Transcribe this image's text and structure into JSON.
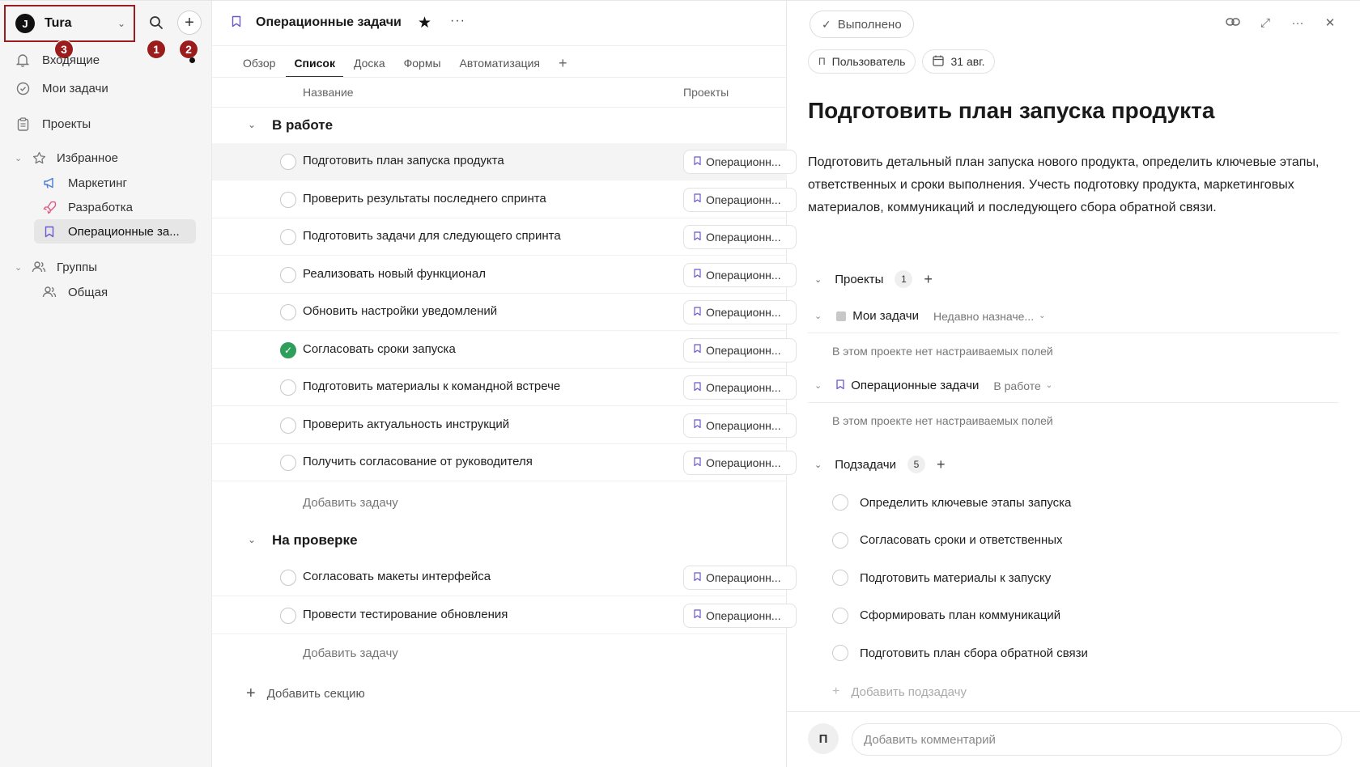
{
  "sidebar": {
    "workspace": {
      "logo": "J",
      "name": "Tura"
    },
    "badges": [
      "1",
      "2",
      "3"
    ],
    "nav": {
      "inbox": "Входящие",
      "my_tasks": "Мои задачи",
      "projects": "Проекты"
    },
    "favorites": {
      "label": "Избранное",
      "items": [
        "Маркетинг",
        "Разработка",
        "Операционные за..."
      ]
    },
    "groups": {
      "label": "Группы",
      "items": [
        "Общая"
      ]
    }
  },
  "middle": {
    "project_title": "Операционные задачи",
    "tabs": [
      "Обзор",
      "Список",
      "Доска",
      "Формы",
      "Автоматизация"
    ],
    "active_tab": "Список",
    "columns": {
      "name": "Название",
      "projects": "Проекты"
    },
    "sections": [
      {
        "title": "В работе",
        "tasks": [
          {
            "name": "Подготовить план запуска продукта",
            "project": "Операционн...",
            "done": false
          },
          {
            "name": "Проверить результаты последнего спринта",
            "project": "Операционн...",
            "done": false
          },
          {
            "name": "Подготовить задачи для следующего спринта",
            "project": "Операционн...",
            "done": false
          },
          {
            "name": "Реализовать новый функционал",
            "project": "Операционн...",
            "done": false
          },
          {
            "name": "Обновить настройки уведомлений",
            "project": "Операционн...",
            "done": false
          },
          {
            "name": "Согласовать сроки запуска",
            "project": "Операционн...",
            "done": true
          },
          {
            "name": "Подготовить материалы к командной встрече",
            "project": "Операционн...",
            "done": false
          },
          {
            "name": "Проверить актуальность инструкций",
            "project": "Операционн...",
            "done": false
          },
          {
            "name": "Получить согласование от руководителя",
            "project": "Операционн...",
            "done": false
          }
        ],
        "add_task": "Добавить задачу"
      },
      {
        "title": "На проверке",
        "tasks": [
          {
            "name": "Согласовать макеты интерфейса",
            "project": "Операционн...",
            "done": false
          },
          {
            "name": "Провести тестирование обновления",
            "project": "Операционн...",
            "done": false
          }
        ],
        "add_task": "Добавить задачу"
      }
    ],
    "add_section": "Добавить секцию"
  },
  "detail": {
    "done_label": "Выполнено",
    "assignee_initial": "П",
    "assignee": "Пользователь",
    "due_date": "31 авг.",
    "title": "Подготовить план запуска продукта",
    "description": "Подготовить детальный план запуска нового продукта, определить ключевые этапы, ответственных и сроки выполнения. Учесть подготовку продукта, маркетинговых материалов, коммуникаций и последующего сбора обратной связи.",
    "projects_label": "Проекты",
    "projects_count": "1",
    "project_lines": [
      {
        "name": "Мои задачи",
        "status": "Недавно назначе...",
        "note": "В этом проекте нет настраиваемых полей"
      },
      {
        "name": "Операционные задачи",
        "status": "В работе",
        "note": "В этом проекте нет настраиваемых полей"
      }
    ],
    "subtasks_label": "Подзадачи",
    "subtasks_count": "5",
    "subtasks": [
      "Определить ключевые этапы запуска",
      "Согласовать сроки и ответственных",
      "Подготовить материалы к запуску",
      "Сформировать план коммуникаций",
      "Подготовить план сбора обратной связи"
    ],
    "add_subtask": "Добавить подзадачу",
    "comment_avatar": "П",
    "comment_placeholder": "Добавить комментарий"
  }
}
